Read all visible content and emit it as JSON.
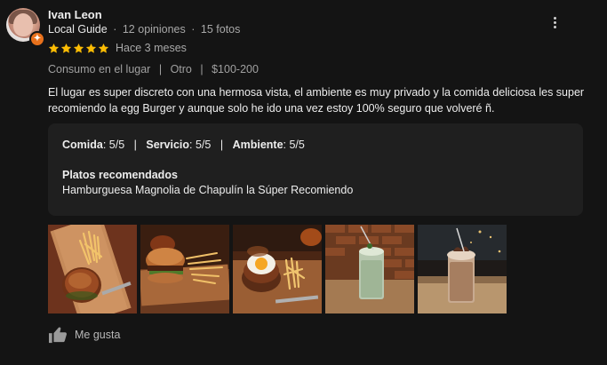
{
  "reviewer": {
    "name": "Ivan Leon",
    "badge": "Local Guide",
    "reviews": "12 opiniones",
    "photos": "15 fotos"
  },
  "rating": {
    "stars": 5,
    "max": 5,
    "time": "Hace 3 meses"
  },
  "meta": {
    "service": "Consumo en el lugar",
    "meal": "Otro",
    "price": "$100-200"
  },
  "review_text": "El lugar es super discreto con una hermosa vista, el ambiente es muy privado y la comida deliciosa les super recomiendo la egg Burger y aunque solo he ido una vez estoy 100% seguro que volveré ñ.",
  "attributes": [
    {
      "label": "Comida",
      "value": ": 5/5"
    },
    {
      "label": "Servicio",
      "value": ": 5/5"
    },
    {
      "label": "Ambiente",
      "value": ": 5/5"
    }
  ],
  "attr_separator": "|",
  "meta_separator": "|",
  "subline_separator": "·",
  "recommended": {
    "title": "Platos recomendados",
    "value": "Hamburguesa Magnolia de Chapulín la Súper Recomiendo"
  },
  "actions": {
    "like_label": "Me gusta"
  },
  "colors": {
    "star": "#fbbc04",
    "badge": "#e8711c",
    "card_bg": "#1f1f1f",
    "page_bg": "#141414"
  },
  "icons": {
    "more": "more-vert-icon",
    "like": "thumb-up-icon",
    "badge": "local-guide-badge-icon",
    "star": "star-icon"
  }
}
